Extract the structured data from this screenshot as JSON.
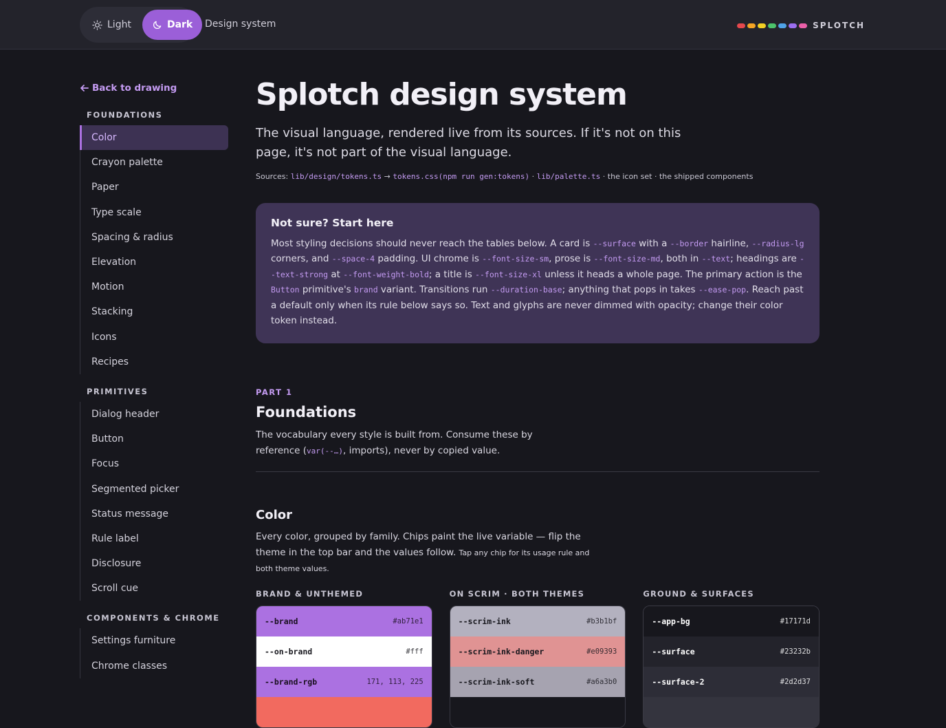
{
  "topbar": {
    "theme_options": [
      {
        "label": "Light",
        "icon": "sun-icon",
        "active": false
      },
      {
        "label": "Dark",
        "icon": "moon-icon",
        "active": true
      }
    ],
    "title": "Design system",
    "brand_name": "SPLOTCH",
    "brand_dots": [
      "#e5484d",
      "#f5a524",
      "#f2d024",
      "#4cc36b",
      "#4fa3e8",
      "#9b6ef0",
      "#ea5fa8"
    ]
  },
  "sidebar": {
    "back_label": "Back to drawing",
    "groups": [
      {
        "title": "FOUNDATIONS",
        "items": [
          "Color",
          "Crayon palette",
          "Paper",
          "Type scale",
          "Spacing & radius",
          "Elevation",
          "Motion",
          "Stacking",
          "Icons",
          "Recipes"
        ],
        "active_index": 0
      },
      {
        "title": "PRIMITIVES",
        "items": [
          "Dialog header",
          "Button",
          "Focus",
          "Segmented picker",
          "Status message",
          "Rule label",
          "Disclosure",
          "Scroll cue"
        ]
      },
      {
        "title": "COMPONENTS & CHROME",
        "items": [
          "Settings furniture",
          "Chrome classes"
        ]
      }
    ]
  },
  "main": {
    "title": "Splotch design system",
    "lede": "The visual language, rendered live from its sources. If it's not on this page, it's not part of the visual language.",
    "sources": {
      "prefix": "Sources:",
      "tokens_ts": "lib/design/tokens.ts",
      "arrow": "→",
      "tokens_css": "tokens.css",
      "gen_cmd": "(npm run gen:tokens)",
      "sep1": "·",
      "palette_ts": "lib/palette.ts",
      "rest": "· the icon set · the shipped components"
    },
    "callout": {
      "title": "Not sure? Start here",
      "parts": [
        {
          "t": "Most styling decisions should never reach the tables below. A card is "
        },
        {
          "c": "--surface"
        },
        {
          "t": " with a "
        },
        {
          "c": "--border"
        },
        {
          "t": " hairline, "
        },
        {
          "c": "--radius-lg"
        },
        {
          "t": " corners, and "
        },
        {
          "c": "--space-4"
        },
        {
          "t": " padding. UI chrome is "
        },
        {
          "c": "--font-size-sm"
        },
        {
          "t": ", prose is "
        },
        {
          "c": "--font-size-md"
        },
        {
          "t": ", both in "
        },
        {
          "c": "--text"
        },
        {
          "t": "; headings are "
        },
        {
          "c": "--text-strong"
        },
        {
          "t": " at "
        },
        {
          "c": "--font-weight-bold"
        },
        {
          "t": "; a title is "
        },
        {
          "c": "--font-size-xl"
        },
        {
          "t": " unless it heads a whole page. The primary action is the "
        },
        {
          "c": "Button"
        },
        {
          "t": " primitive's "
        },
        {
          "c": "brand"
        },
        {
          "t": " variant. Transitions run "
        },
        {
          "c": "--duration-base"
        },
        {
          "t": "; anything that pops in takes "
        },
        {
          "c": "--ease-pop"
        },
        {
          "t": ". Reach past a default only when its rule below says so. Text and glyphs are never dimmed with opacity; change their color token instead."
        }
      ]
    },
    "part": {
      "label": "PART 1",
      "title": "Foundations",
      "desc_before": "The vocabulary every style is built from. Consume these by reference (",
      "desc_code": "var(--…)",
      "desc_after": ", imports), never by copied value."
    },
    "color_section": {
      "title": "Color",
      "desc": "Every color, grouped by family. Chips paint the live variable — flip the theme in the top bar and the values follow.",
      "desc_small": "Tap any chip for its usage rule and both theme values.",
      "groups": [
        {
          "title": "BRAND & UNTHEMED",
          "chips": [
            {
              "name": "--brand",
              "value": "#ab71e1",
              "bg": "#ab71e1",
              "fg": "#1a1020"
            },
            {
              "name": "--on-brand",
              "value": "#fff",
              "bg": "#ffffff",
              "fg": "#17171d"
            },
            {
              "name": "--brand-rgb",
              "value": "171, 113, 225",
              "bg": "#ab71e1",
              "fg": "#1a1020"
            },
            {
              "name": "",
              "value": "",
              "bg": "#f26a5f",
              "fg": "#17171d"
            }
          ]
        },
        {
          "title": "ON SCRIM · BOTH THEMES",
          "chips": [
            {
              "name": "--scrim-ink",
              "value": "#b3b1bf",
              "bg": "#b3b1bf",
              "fg": "#17171d"
            },
            {
              "name": "--scrim-ink-danger",
              "value": "#e09393",
              "bg": "#e09393",
              "fg": "#17171d"
            },
            {
              "name": "--scrim-ink-soft",
              "value": "#a6a3b0",
              "bg": "#a6a3b0",
              "fg": "#17171d"
            },
            {
              "name": "",
              "value": "",
              "bg": "#17171d",
              "fg": "#ffffff"
            }
          ]
        },
        {
          "title": "GROUND & SURFACES",
          "chips": [
            {
              "name": "--app-bg",
              "value": "#17171d",
              "bg": "#17171d",
              "fg": "#ffffff"
            },
            {
              "name": "--surface",
              "value": "#23232b",
              "bg": "#23232b",
              "fg": "#ffffff"
            },
            {
              "name": "--surface-2",
              "value": "#2d2d37",
              "bg": "#2d2d37",
              "fg": "#ffffff"
            },
            {
              "name": "",
              "value": "",
              "bg": "#34343e",
              "fg": "#ffffff"
            }
          ]
        }
      ]
    }
  }
}
